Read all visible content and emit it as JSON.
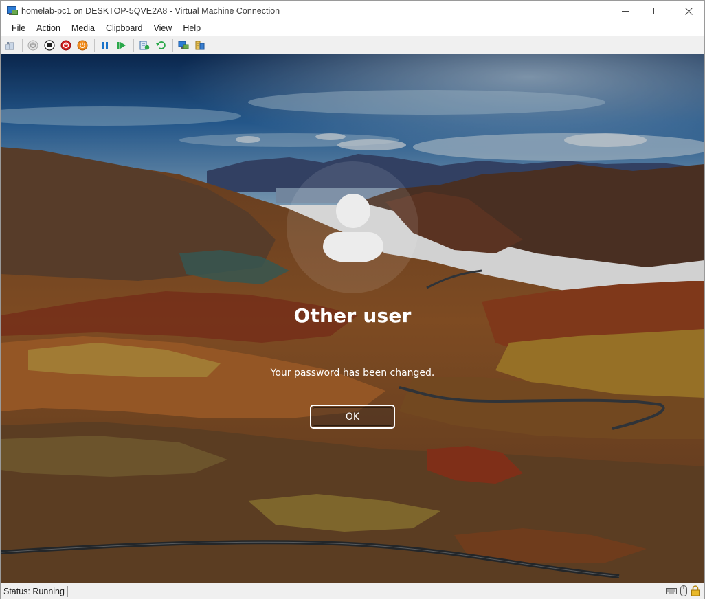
{
  "window": {
    "title": "homelab-pc1 on DESKTOP-5QVE2A8 - Virtual Machine Connection",
    "icon": "vm-connection-icon"
  },
  "menu": {
    "items": [
      {
        "label": "File"
      },
      {
        "label": "Action"
      },
      {
        "label": "Media"
      },
      {
        "label": "Clipboard"
      },
      {
        "label": "View"
      },
      {
        "label": "Help"
      }
    ]
  },
  "toolbar": {
    "buttons": [
      "ctrl-alt-del-icon",
      "start-icon",
      "turn-off-icon",
      "shut-down-icon",
      "power-icon",
      "pause-icon",
      "resume-icon",
      "checkpoint-icon",
      "revert-icon",
      "enhanced-session-icon",
      "share-icon"
    ]
  },
  "lockscreen": {
    "user_name": "Other user",
    "message": "Your password has been changed.",
    "ok_label": "OK"
  },
  "status": {
    "text": "Status: Running"
  },
  "colors": {
    "accent_blue": "#1a73c9",
    "status_bg": "#f0f0f0"
  }
}
